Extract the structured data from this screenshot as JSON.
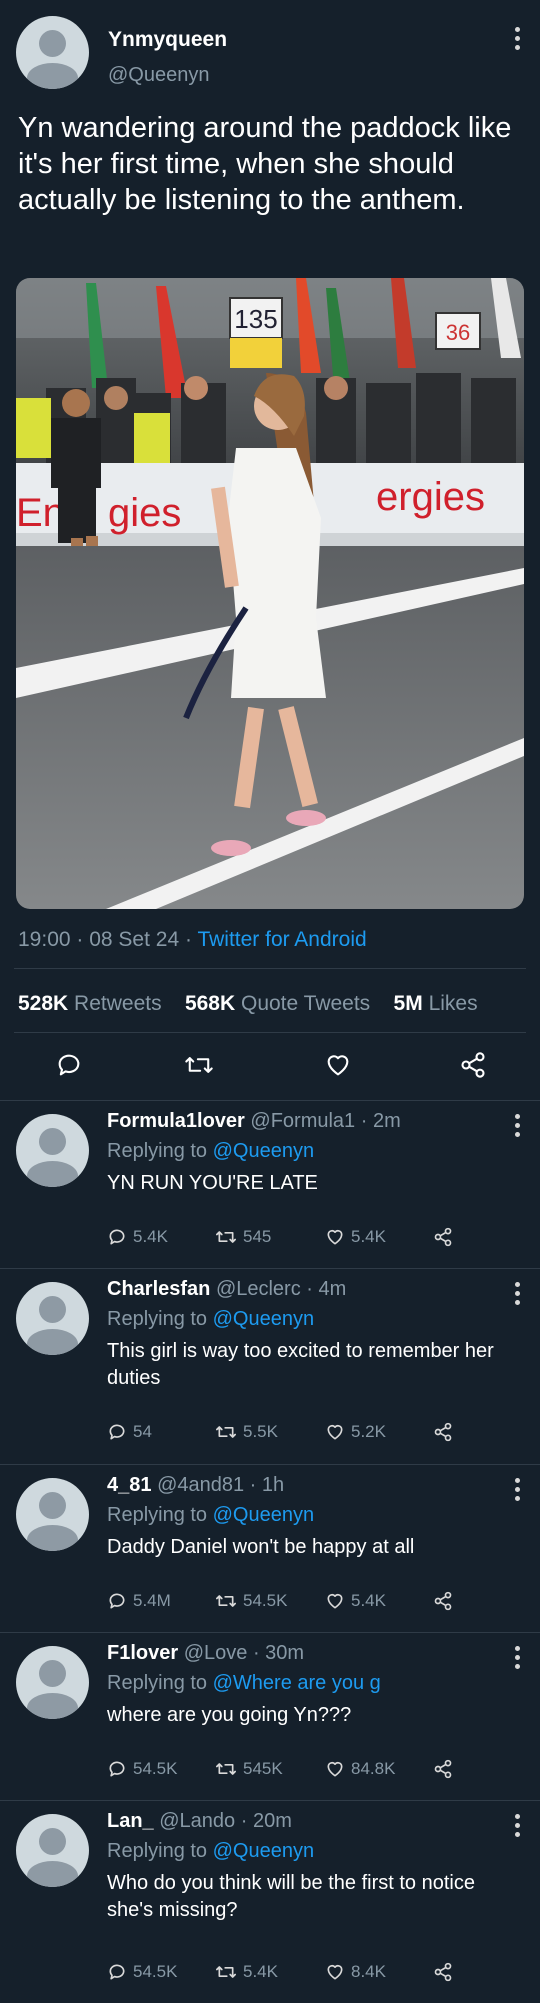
{
  "main_tweet": {
    "display_name": "Ynmyqueen",
    "handle": "@Queenyn",
    "text": "Yn wandering around the paddock like it's her first time, when she should actually be listening to the anthem.",
    "photo": {
      "banner_left": "Ene",
      "banner_mid": "gies",
      "banner_right": "ergies",
      "sign_left": "135",
      "sign_right": "36"
    },
    "time": "19:00",
    "date": "08 Set 24",
    "client": "Twitter for Android",
    "retweets": "528K",
    "retweets_label": "Retweets",
    "quotes": "568K",
    "quotes_label": "Quote Tweets",
    "likes": "5M",
    "likes_label": "Likes"
  },
  "replies": [
    {
      "name": "Formula1lover",
      "handle": "@Formula1",
      "time": "2m",
      "replying_prefix": "Replying to",
      "replying_to": "@Queenyn",
      "text": "YN RUN YOU'RE LATE",
      "replies_count": "5.4K",
      "retweets_count": "545",
      "likes_count": "5.4K"
    },
    {
      "name": "Charlesfan",
      "handle": "@Leclerc",
      "time": "4m",
      "replying_prefix": "Replying to",
      "replying_to": "@Queenyn",
      "text": "This girl is way too excited to remember her duties",
      "replies_count": "54",
      "retweets_count": "5.5K",
      "likes_count": "5.2K"
    },
    {
      "name": "4_81",
      "handle": "@4and81",
      "time": "1h",
      "replying_prefix": "Replying to",
      "replying_to": "@Queenyn",
      "text": "Daddy Daniel won't be happy at all",
      "replies_count": "5.4M",
      "retweets_count": "54.5K",
      "likes_count": "5.4K"
    },
    {
      "name": "F1lover",
      "handle": "@Love",
      "time": "30m",
      "replying_prefix": "Replying to",
      "replying_to": "@Where are you g",
      "text": "where are you going Yn???",
      "replies_count": "54.5K",
      "retweets_count": "545K",
      "likes_count": "84.8K"
    },
    {
      "name": "Lan_",
      "handle": "@Lando",
      "time": "20m",
      "replying_prefix": "Replying to",
      "replying_to": "@Queenyn",
      "text": "Who do you think will be the first to notice she's missing?",
      "replies_count": "54.5K",
      "retweets_count": "5.4K",
      "likes_count": "8.4K"
    }
  ],
  "colors": {
    "background": "#15202b",
    "link": "#1d9bf0",
    "muted": "#8899a6",
    "divider": "#2f3b47"
  },
  "icons": {
    "reply": "reply-icon",
    "retweet": "retweet-icon",
    "like": "heart-icon",
    "share": "share-icon",
    "more": "more-vertical-icon"
  }
}
